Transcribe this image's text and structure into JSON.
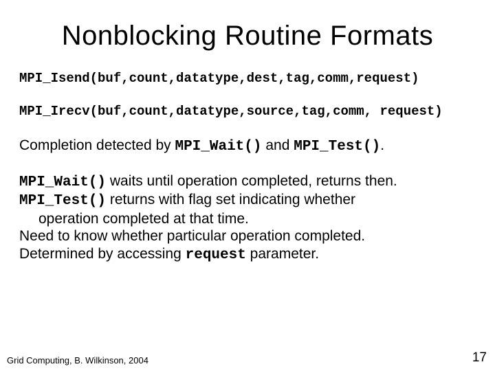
{
  "slide": {
    "title": "Nonblocking Routine Formats",
    "code1": "MPI_Isend(buf,count,datatype,dest,tag,comm,request)",
    "code2": "MPI_Irecv(buf,count,datatype,source,tag,comm, request)",
    "completion": {
      "prefix": "Completion detected by ",
      "fn1": "MPI_Wait()",
      "mid": " and ",
      "fn2": "MPI_Test()",
      "suffix": "."
    },
    "body": {
      "l1a": "MPI_Wait()",
      "l1b": " waits until operation completed, returns then.",
      "l2a": "MPI_Test()",
      "l2b": " returns with flag set indicating whether",
      "l3": "operation completed at that time.",
      "l4": "Need to know whether particular operation completed.",
      "l5a": "Determined by accessing ",
      "l5b": "request",
      "l5c": " parameter."
    },
    "footer": {
      "left": "Grid Computing, B. Wilkinson, 2004",
      "right": "17"
    }
  }
}
